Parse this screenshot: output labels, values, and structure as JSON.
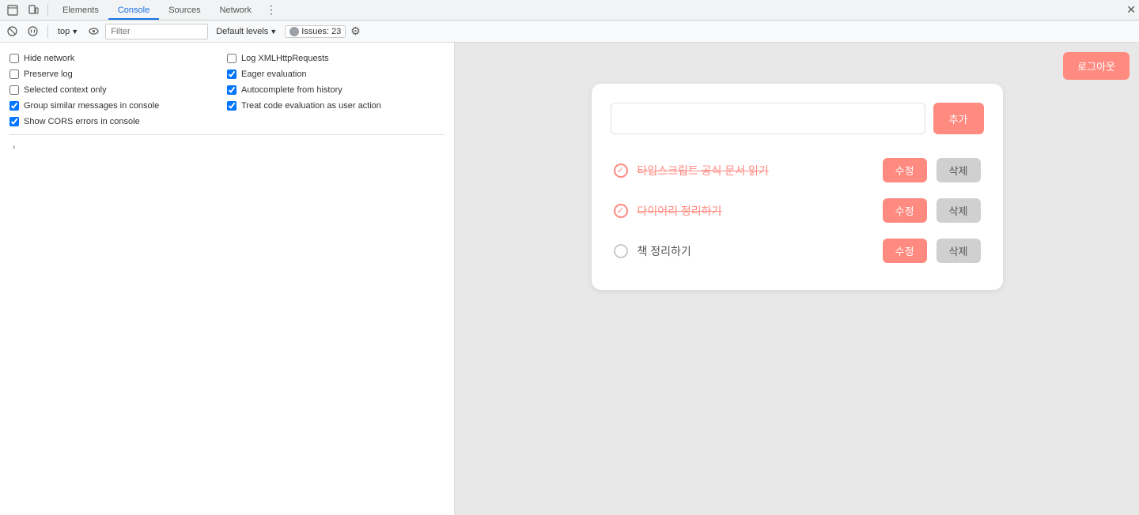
{
  "devtools": {
    "tabs": [
      {
        "label": "Elements",
        "active": false
      },
      {
        "label": "Console",
        "active": true
      },
      {
        "label": "Sources",
        "active": false
      },
      {
        "label": "Network",
        "active": false
      }
    ],
    "tab_badge_count": "23",
    "toolbar": {
      "context": "top",
      "filter_placeholder": "Filter",
      "levels_label": "Default levels",
      "issues_label": "Issues:",
      "issues_count": "23"
    },
    "settings": {
      "col1": [
        {
          "label": "Hide network",
          "checked": false
        },
        {
          "label": "Preserve log",
          "checked": false
        },
        {
          "label": "Selected context only",
          "checked": false
        },
        {
          "label": "Group similar messages in console",
          "checked": true
        },
        {
          "label": "Show CORS errors in console",
          "checked": true
        }
      ],
      "col2": [
        {
          "label": "Log XMLHttpRequests",
          "checked": false
        },
        {
          "label": "Eager evaluation",
          "checked": true
        },
        {
          "label": "Autocomplete from history",
          "checked": true
        },
        {
          "label": "Treat code evaluation as user action",
          "checked": true
        }
      ]
    }
  },
  "app": {
    "logout_label": "로그아웃",
    "todo_input_placeholder": "",
    "add_label": "추가",
    "items": [
      {
        "text": "타입스크립트 공식 문서 읽기",
        "checked": true,
        "edit_label": "수정",
        "delete_label": "삭제"
      },
      {
        "text": "다이어리 정리하기",
        "checked": true,
        "edit_label": "수정",
        "delete_label": "삭제"
      },
      {
        "text": "책 정리하기",
        "checked": false,
        "edit_label": "수정",
        "delete_label": "삭제"
      }
    ]
  }
}
